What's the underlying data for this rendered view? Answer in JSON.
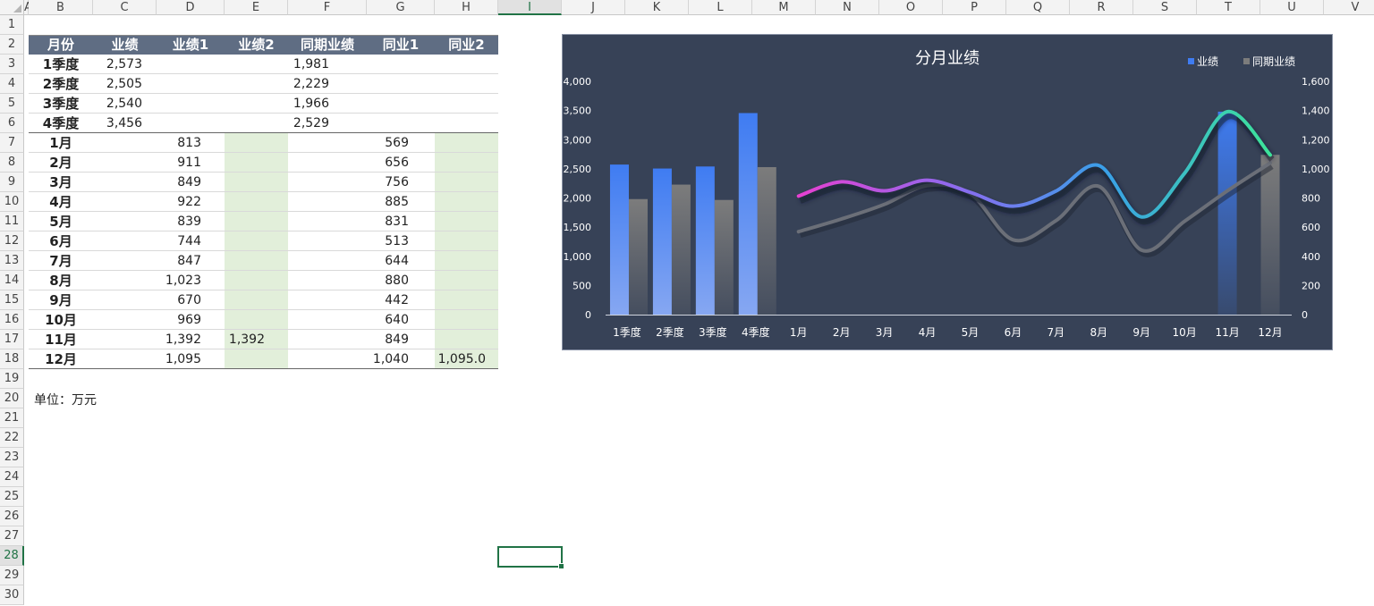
{
  "columns": [
    "A",
    "B",
    "C",
    "D",
    "E",
    "F",
    "G",
    "H",
    "I",
    "J",
    "K",
    "L",
    "M",
    "N",
    "O",
    "P",
    "Q",
    "R",
    "S",
    "T",
    "U",
    "V"
  ],
  "selected_column": "I",
  "rows": [
    "1",
    "2",
    "3",
    "4",
    "5",
    "6",
    "7",
    "8",
    "9",
    "10",
    "11",
    "12",
    "13",
    "14",
    "15",
    "16",
    "17",
    "18",
    "19",
    "20",
    "21",
    "22",
    "23",
    "24",
    "25",
    "26",
    "27",
    "28",
    "29",
    "30"
  ],
  "selected_row": "28",
  "table": {
    "headers": [
      "月份",
      "业绩",
      "业绩1",
      "业绩2",
      "同期业绩",
      "同业1",
      "同业2"
    ],
    "rows": [
      [
        "1季度",
        "2,573",
        "",
        "",
        "1,981",
        "",
        ""
      ],
      [
        "2季度",
        "2,505",
        "",
        "",
        "2,229",
        "",
        ""
      ],
      [
        "3季度",
        "2,540",
        "",
        "",
        "1,966",
        "",
        ""
      ],
      [
        "4季度",
        "3,456",
        "",
        "",
        "2,529",
        "",
        ""
      ],
      [
        "1月",
        "",
        "813",
        "",
        "",
        "569",
        ""
      ],
      [
        "2月",
        "",
        "911",
        "",
        "",
        "656",
        ""
      ],
      [
        "3月",
        "",
        "849",
        "",
        "",
        "756",
        ""
      ],
      [
        "4月",
        "",
        "922",
        "",
        "",
        "885",
        ""
      ],
      [
        "5月",
        "",
        "839",
        "",
        "",
        "831",
        ""
      ],
      [
        "6月",
        "",
        "744",
        "",
        "",
        "513",
        ""
      ],
      [
        "7月",
        "",
        "847",
        "",
        "",
        "644",
        ""
      ],
      [
        "8月",
        "",
        "1,023",
        "",
        "",
        "880",
        ""
      ],
      [
        "9月",
        "",
        "670",
        "",
        "",
        "442",
        ""
      ],
      [
        "10月",
        "",
        "969",
        "",
        "",
        "640",
        ""
      ],
      [
        "11月",
        "",
        "1,392",
        "1,392",
        "",
        "849",
        ""
      ],
      [
        "12月",
        "",
        "1,095",
        "",
        "",
        "1,040",
        "1,095.0"
      ]
    ]
  },
  "unit_note": "单位：万元",
  "colors": {
    "header_bg": "#5f6d83",
    "green_fill": "#e2efda",
    "chart_bg": "#374257",
    "selection": "#217346"
  },
  "chart_data": {
    "type": "bar",
    "title": "分月业绩",
    "legend": {
      "placement": "top-right",
      "entries": [
        "业绩",
        "同期业绩"
      ]
    },
    "categories": [
      "1季度",
      "2季度",
      "3季度",
      "4季度",
      "1月",
      "2月",
      "3月",
      "4月",
      "5月",
      "6月",
      "7月",
      "8月",
      "9月",
      "10月",
      "11月",
      "12月"
    ],
    "y_left": {
      "ticks": [
        "0",
        "500",
        "1,000",
        "1,500",
        "2,000",
        "2,500",
        "3,000",
        "3,500",
        "4,000"
      ],
      "ylim": [
        0,
        4000
      ]
    },
    "y_right": {
      "ticks": [
        "0",
        "200",
        "400",
        "600",
        "800",
        "1,000",
        "1,200",
        "1,400",
        "1,600"
      ],
      "ylim": [
        0,
        1600
      ]
    },
    "series": [
      {
        "name": "业绩",
        "kind": "bar",
        "axis": "left",
        "values": [
          2573,
          2505,
          2540,
          3456,
          null,
          null,
          null,
          null,
          null,
          null,
          null,
          null,
          null,
          null,
          3480,
          null
        ]
      },
      {
        "name": "同期业绩",
        "kind": "bar",
        "axis": "left",
        "values": [
          1981,
          2229,
          1966,
          2529,
          null,
          null,
          null,
          null,
          null,
          null,
          null,
          null,
          null,
          null,
          null,
          2740
        ]
      },
      {
        "kind": "line",
        "axis": "right",
        "smooth": true,
        "gradient": [
          "#e83fd0",
          "#8a6cf0",
          "#3a9fe8",
          "#3de39a"
        ],
        "values": [
          null,
          null,
          null,
          null,
          813,
          911,
          849,
          922,
          839,
          744,
          847,
          1023,
          670,
          969,
          1392,
          1095
        ]
      },
      {
        "kind": "line",
        "axis": "right",
        "smooth": true,
        "color": "#6b6f78",
        "values": [
          null,
          null,
          null,
          null,
          569,
          656,
          756,
          885,
          831,
          513,
          644,
          880,
          442,
          640,
          849,
          1040
        ]
      }
    ]
  }
}
